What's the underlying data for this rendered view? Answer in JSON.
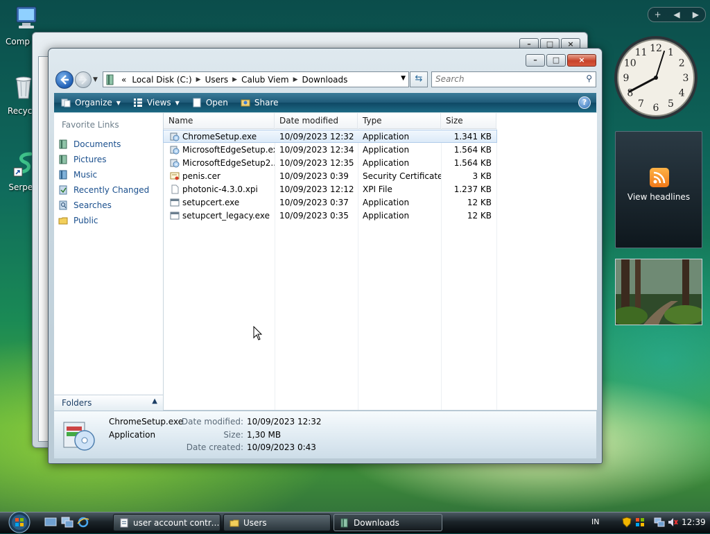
{
  "desktop": {
    "icons": [
      {
        "label": "Comp",
        "icon": "computer-icon"
      },
      {
        "label": "Recycle",
        "icon": "recycle-bin-icon"
      },
      {
        "label": "Serpent",
        "icon": "serpent-shortcut-icon"
      }
    ]
  },
  "window": {
    "address": {
      "segments": [
        "Local Disk (C:)",
        "Users",
        "Calub Viem",
        "Downloads"
      ],
      "overflow": "«"
    },
    "search_placeholder": "Search",
    "toolbar": {
      "organize": "Organize",
      "views": "Views",
      "open": "Open",
      "share": "Share"
    },
    "nav": {
      "favorite_title": "Favorite Links",
      "items": [
        "Documents",
        "Pictures",
        "Music",
        "Recently Changed",
        "Searches",
        "Public"
      ],
      "folders_label": "Folders"
    },
    "columns": {
      "name": "Name",
      "date": "Date modified",
      "type": "Type",
      "size": "Size"
    },
    "files": [
      {
        "name": "ChromeSetup.exe",
        "date": "10/09/2023 12:32",
        "type": "Application",
        "size": "1.341 KB",
        "icon": "installer-icon"
      },
      {
        "name": "MicrosoftEdgeSetup.exe",
        "date": "10/09/2023 12:34",
        "type": "Application",
        "size": "1.564 KB",
        "icon": "installer-icon"
      },
      {
        "name": "MicrosoftEdgeSetup2....",
        "date": "10/09/2023 12:35",
        "type": "Application",
        "size": "1.564 KB",
        "icon": "installer-icon"
      },
      {
        "name": "penis.cer",
        "date": "10/09/2023 0:39",
        "type": "Security Certificate",
        "size": "3 KB",
        "icon": "certificate-icon"
      },
      {
        "name": "photonic-4.3.0.xpi",
        "date": "10/09/2023 12:12",
        "type": "XPI File",
        "size": "1.237 KB",
        "icon": "blank-file-icon"
      },
      {
        "name": "setupcert.exe",
        "date": "10/09/2023 0:37",
        "type": "Application",
        "size": "12 KB",
        "icon": "app-window-icon"
      },
      {
        "name": "setupcert_legacy.exe",
        "date": "10/09/2023 0:35",
        "type": "Application",
        "size": "12 KB",
        "icon": "app-window-icon"
      }
    ],
    "details": {
      "name": "ChromeSetup.exe",
      "type": "Application",
      "modified_label": "Date modified:",
      "modified_value": "10/09/2023 12:32",
      "size_label": "Size:",
      "size_value": "1,30 MB",
      "created_label": "Date created:",
      "created_value": "10/09/2023 0:43"
    }
  },
  "gadgets": {
    "feeds_label": "View headlines",
    "clock_numbers": [
      "12",
      "1",
      "2",
      "3",
      "4",
      "5",
      "6",
      "7",
      "8",
      "9",
      "10",
      "11"
    ]
  },
  "taskbar": {
    "tasks": [
      {
        "label": "user account contro...",
        "icon": "document-icon"
      },
      {
        "label": "Users",
        "icon": "folder-icon"
      },
      {
        "label": "Downloads",
        "icon": "folder-icon"
      }
    ],
    "lang": "IN",
    "time": "12:39"
  },
  "colors": {
    "toolbar": "#1f5a78",
    "link": "#1a4f8d",
    "selection": "#dceaf8"
  }
}
